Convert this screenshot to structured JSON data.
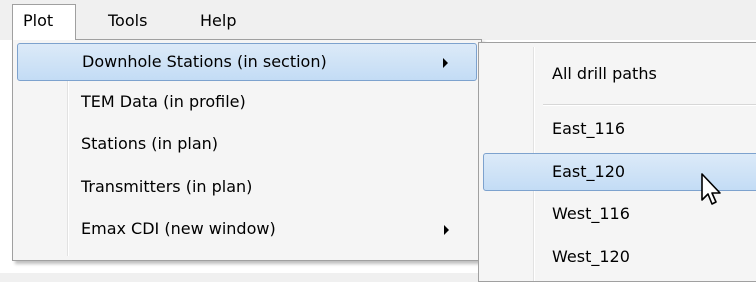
{
  "menubar": {
    "items": [
      {
        "label": "Plot"
      },
      {
        "label": "Tools"
      },
      {
        "label": "Help"
      }
    ]
  },
  "plot_menu": {
    "items": [
      {
        "label": "Downhole Stations (in section)",
        "has_submenu": true,
        "highlighted": true
      },
      {
        "label": "TEM Data (in profile)",
        "has_submenu": false
      },
      {
        "label": "Stations (in plan)",
        "has_submenu": false
      },
      {
        "label": "Transmitters (in plan)",
        "has_submenu": false
      },
      {
        "label": "Emax CDI (new window)",
        "has_submenu": true
      }
    ]
  },
  "submenu": {
    "items": [
      {
        "label": "All drill paths"
      },
      {
        "label": "East_116"
      },
      {
        "label": "East_120",
        "highlighted": true
      },
      {
        "label": "West_116"
      },
      {
        "label": "West_120"
      }
    ]
  },
  "colors": {
    "highlight_fill": "#c3dcf5",
    "highlight_border": "#7da2ce",
    "menu_bg": "#f5f5f5",
    "menubar_bg": "#f0f0f0"
  },
  "icons": {
    "submenu_arrow": "triangle-right",
    "cursor": "arrow-pointer"
  }
}
